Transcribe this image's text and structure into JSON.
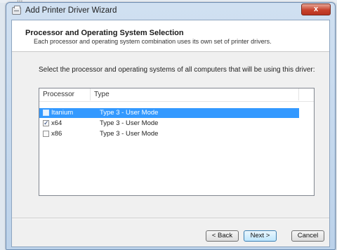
{
  "background_window": {
    "menu_text": "..."
  },
  "window": {
    "title": "Add Printer Driver Wizard",
    "close_glyph": "x"
  },
  "header": {
    "title": "Processor and Operating System Selection",
    "subtitle": "Each processor and operating system combination uses its own set of printer drivers."
  },
  "instruction": "Select the processor and operating systems of all computers that will be using this driver:",
  "list": {
    "columns": [
      "Processor",
      "Type"
    ],
    "rows": [
      {
        "processor": "Itanium",
        "type": "Type 3 - User Mode",
        "checked": false,
        "selected": true,
        "check_glyph": ""
      },
      {
        "processor": "x64",
        "type": "Type 3 - User Mode",
        "checked": true,
        "selected": false,
        "check_glyph": "✓"
      },
      {
        "processor": "x86",
        "type": "Type 3 - User Mode",
        "checked": false,
        "selected": false,
        "check_glyph": ""
      }
    ]
  },
  "buttons": {
    "back": "< Back",
    "next": "Next >",
    "cancel": "Cancel"
  },
  "colors": {
    "selection": "#3399ff",
    "close_button": "#c8432d",
    "window_frame": "#bcd2ea"
  }
}
